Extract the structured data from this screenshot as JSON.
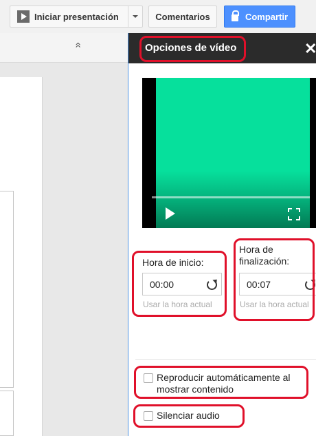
{
  "toolbar": {
    "present_label": "Iniciar presentación",
    "comments_label": "Comentarios",
    "share_label": "Compartir"
  },
  "icons": {
    "present": "play-square-icon",
    "dropdown": "chevron-down-icon",
    "share": "lock-icon",
    "collapse": "double-chevron-up-icon",
    "close": "close-icon",
    "play": "play-icon",
    "fullscreen": "fullscreen-icon",
    "refresh": "refresh-icon"
  },
  "colors": {
    "share_button": "#4d90fe",
    "panel_header": "#2b2b2b",
    "video_green": "#06e09c",
    "highlight": "#e0102a"
  },
  "panel": {
    "title": "Opciones de vídeo",
    "close_glyph": "✕",
    "start": {
      "label": "Hora de inicio:",
      "value": "00:00",
      "hint": "Usar la hora actual"
    },
    "end": {
      "label_line1": "Hora de",
      "label_line2": "finalización:",
      "value": "00:07",
      "hint": "Usar la hora actual"
    },
    "autoplay": {
      "label_line1": "Reproducir automáticamente al",
      "label_line2": "mostrar contenido",
      "checked": false
    },
    "mute": {
      "label": "Silenciar audio",
      "checked": false
    }
  },
  "collapse_glyph": "»"
}
